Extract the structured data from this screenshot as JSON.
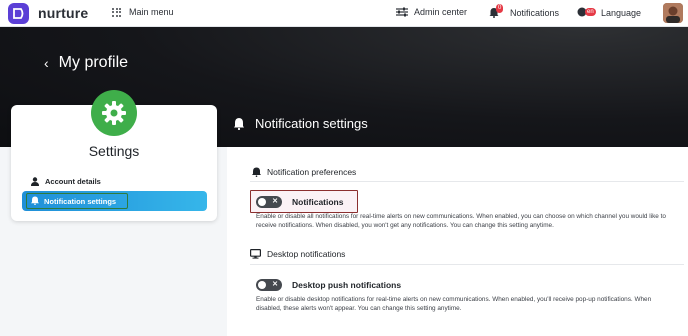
{
  "app": {
    "name": "nurture",
    "main_menu": "Main menu"
  },
  "top": {
    "admin_center": "Admin center",
    "notifications": "Notifications",
    "notifications_badge": "0",
    "language": "Language",
    "language_badge": "en"
  },
  "header": {
    "back_title": "My profile"
  },
  "sidebar": {
    "title": "Settings",
    "items": [
      {
        "label": "Account details"
      },
      {
        "label": "Notification settings"
      }
    ]
  },
  "main": {
    "title": "Notification settings",
    "preferences": {
      "heading": "Notification preferences",
      "toggle_label": "Notifications",
      "description": "Enable or disable all notifications for real-time alerts on new communications. When enabled, you can choose on which channel you would like to receive notifications. When disabled, you won't get any notifications. You can change this setting anytime."
    },
    "desktop": {
      "heading": "Desktop notifications",
      "toggle_label": "Desktop push notifications",
      "description": "Enable or disable desktop notifications for real-time alerts on new communications. When enabled, you'll receive pop-up notifications. When disabled, these alerts won't appear. You can change this setting anytime."
    }
  },
  "colors": {
    "brand": "#5b3fd6",
    "active": "#1f8fd8",
    "gear": "#3fae4a",
    "badge": "#e53945"
  }
}
